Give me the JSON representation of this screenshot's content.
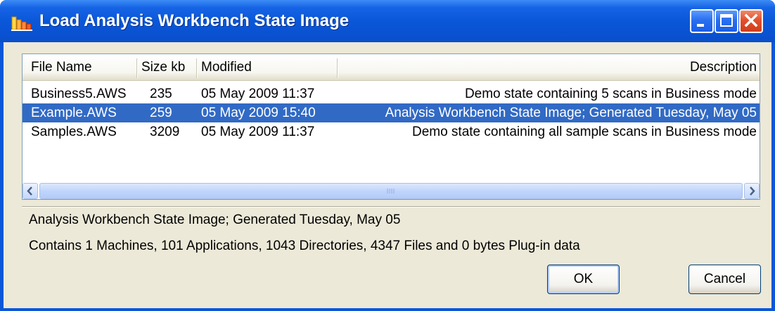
{
  "window": {
    "title": "Load Analysis Workbench State Image",
    "controls": {
      "minimize": "minimize",
      "maximize": "maximize",
      "close": "close"
    }
  },
  "list": {
    "columns": [
      {
        "key": "name",
        "label": "File Name"
      },
      {
        "key": "size",
        "label": "Size kb"
      },
      {
        "key": "modified",
        "label": "Modified"
      },
      {
        "key": "description",
        "label": "Description"
      }
    ],
    "rows": [
      {
        "name": "Business5.AWS",
        "size": "235",
        "modified": "05 May 2009 11:37",
        "description": "Demo state containing 5 scans in Business mode",
        "selected": false
      },
      {
        "name": "Example.AWS",
        "size": "259",
        "modified": "05 May 2009 15:40",
        "description": "Analysis Workbench State Image; Generated Tuesday, May 05",
        "selected": true
      },
      {
        "name": "Samples.AWS",
        "size": "3209",
        "modified": "05 May 2009 11:37",
        "description": "Demo state containing all sample scans in Business mode",
        "selected": false
      }
    ]
  },
  "details": {
    "line1": "Analysis Workbench State Image; Generated Tuesday, May 05",
    "line2": "Contains 1 Machines, 101 Applications, 1043 Directories, 4347 Files and 0 bytes Plug-in data"
  },
  "buttons": {
    "ok": "OK",
    "cancel": "Cancel"
  },
  "colors": {
    "titlebar": "#0a57d8",
    "selection": "#316ac5",
    "dialog_background": "#ece9d8"
  }
}
